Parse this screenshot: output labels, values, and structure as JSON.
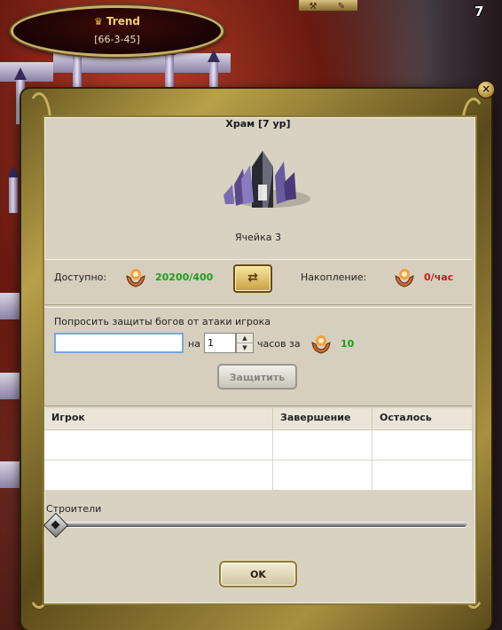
{
  "header": {
    "player_name": "Trend",
    "coordinates": "[66-3-45]",
    "corner_count": "7",
    "map_counts": [
      "7",
      "7"
    ]
  },
  "dialog": {
    "title": "Храм [7 ур]",
    "cell_label": "Ячейка 3",
    "close_symbol": "×",
    "available_label": "Доступно:",
    "available_value": "20200/400",
    "accumulation_label": "Накопление:",
    "accumulation_value": "0/час",
    "protect_prompt": "Попросить защиты богов от атаки игрока",
    "player_input_value": "",
    "on_label": "на",
    "hours_value": "1",
    "hours_label": "часов за",
    "cost_value": "10",
    "protect_button": "Защитить",
    "table": {
      "columns": [
        "Игрок",
        "Завершение",
        "Осталось"
      ],
      "rows": [
        [
          "",
          "",
          ""
        ],
        [
          "",
          "",
          ""
        ]
      ]
    },
    "builders_label": "Строители",
    "builders_slider_fraction": 0,
    "ok_button": "OK"
  },
  "colors": {
    "accent_green": "#1aa01a",
    "accent_red": "#d01a1a",
    "frame_gold": "#b8a048",
    "panel_bg": "#d8d2c2"
  },
  "icons": [
    "crown-icon",
    "hands-orb-icon",
    "exchange-icon",
    "close-icon",
    "temple-icon",
    "spinner-up-icon",
    "spinner-down-icon"
  ]
}
